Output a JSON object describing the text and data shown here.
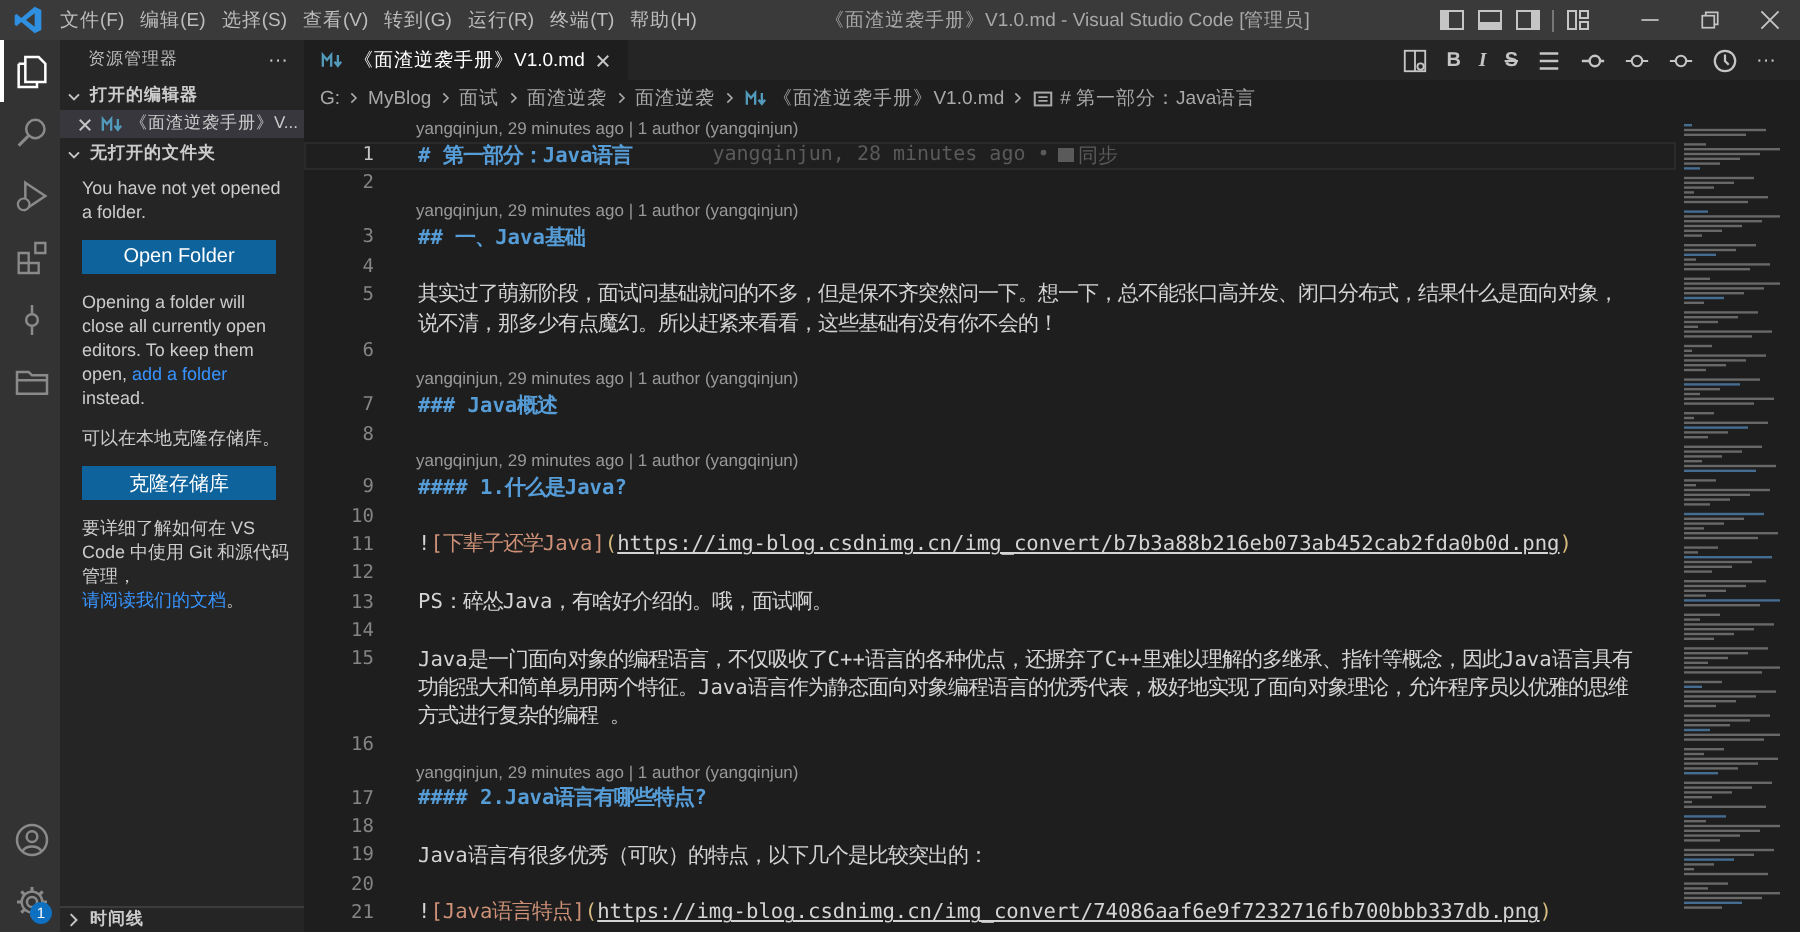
{
  "title_bar": {
    "menus": [
      "文件(F)",
      "编辑(E)",
      "选择(S)",
      "查看(V)",
      "转到(G)",
      "运行(R)",
      "终端(T)",
      "帮助(H)"
    ],
    "title": "《面渣逆袭手册》V1.0.md - Visual Studio Code [管理员]"
  },
  "activity_bar": {
    "items": [
      {
        "kind": "files",
        "selected": true
      },
      {
        "kind": "search",
        "selected": false
      },
      {
        "kind": "run",
        "selected": false
      },
      {
        "kind": "extensions",
        "selected": false
      },
      {
        "kind": "scm",
        "selected": false
      },
      {
        "kind": "folder",
        "selected": false
      }
    ],
    "bottom": [
      {
        "kind": "account"
      },
      {
        "kind": "gear",
        "badge": "1"
      }
    ]
  },
  "sidebar": {
    "title": "资源管理器",
    "more": "···",
    "sections": [
      {
        "kind": "open_editors",
        "title": "打开的编辑器",
        "expanded": true,
        "items": [
          {
            "label": "《面渣逆袭手册》V..."
          }
        ]
      },
      {
        "kind": "welcome",
        "title": "无打开的文件夹",
        "expanded": true,
        "blocks": [
          {
            "kind": "para",
            "parts": [
              {
                "kind": "text",
                "text": "You have not yet opened a folder."
              }
            ]
          },
          {
            "kind": "button",
            "text": "Open Folder"
          },
          {
            "kind": "para",
            "parts": [
              {
                "kind": "text",
                "text": "Opening a folder will close all currently open editors. To keep them open, "
              },
              {
                "kind": "link",
                "text": "add a folder"
              },
              {
                "kind": "text",
                "text": " instead."
              }
            ]
          },
          {
            "kind": "para",
            "parts": [
              {
                "kind": "text",
                "text": "可以在本地克隆存储库。"
              }
            ]
          },
          {
            "kind": "button",
            "text": "克隆存储库"
          },
          {
            "kind": "para",
            "parts": [
              {
                "kind": "text",
                "text": "要详细了解如何在 VS Code 中使用 Git 和源代码管理，"
              },
              {
                "kind": "link",
                "text": "请阅读我们的文档"
              },
              {
                "kind": "text",
                "text": "。"
              }
            ]
          }
        ]
      },
      {
        "kind": "timeline",
        "title": "时间线",
        "expanded": false
      }
    ]
  },
  "editor": {
    "tab": {
      "label": "《面渣逆袭手册》V1.0.md",
      "selected": true
    },
    "toolbar": [
      {
        "kind": "preview"
      },
      {
        "kind": "bold",
        "text": "B"
      },
      {
        "kind": "italic",
        "text": "I"
      },
      {
        "kind": "strike",
        "text": "S"
      },
      {
        "kind": "list"
      },
      {
        "kind": "commit"
      },
      {
        "kind": "ring"
      },
      {
        "kind": "ring"
      },
      {
        "kind": "history"
      },
      {
        "kind": "more",
        "text": "···"
      }
    ],
    "breadcrumbs": [
      {
        "kind": "folder",
        "text": "G:"
      },
      {
        "kind": "folder",
        "text": "MyBlog"
      },
      {
        "kind": "folder",
        "text": "面试"
      },
      {
        "kind": "folder",
        "text": "面渣逆袭"
      },
      {
        "kind": "folder",
        "text": "面渣逆袭"
      },
      {
        "kind": "file",
        "text": "《面渣逆袭手册》V1.0.md"
      },
      {
        "kind": "symbol",
        "text": "# 第一部分：Java语言"
      }
    ],
    "lines": [
      {
        "kind": "codelens",
        "text": "yangqinjun, 29 minutes ago | 1 author (yangqinjun)"
      },
      {
        "kind": "code",
        "number": "1",
        "current": true,
        "rows": [
          [
            {
              "kind": "heading",
              "text": "# 第一部分：Java语言"
            }
          ]
        ],
        "blame": {
          "text": "yangqinjun, 28 minutes ago •",
          "sync": "同步"
        }
      },
      {
        "kind": "code",
        "number": "2",
        "current": false
      },
      {
        "kind": "codelens",
        "text": "yangqinjun, 29 minutes ago | 1 author (yangqinjun)"
      },
      {
        "kind": "code",
        "number": "3",
        "current": false,
        "rows": [
          [
            {
              "kind": "heading",
              "text": "## 一、Java基础"
            }
          ]
        ]
      },
      {
        "kind": "code",
        "number": "4",
        "current": false
      },
      {
        "kind": "code",
        "number": "5",
        "current": false,
        "rows": [
          [
            {
              "kind": "plain",
              "text": "其实过了萌新阶段，面试问基础就问的不多，但是保不齐突然问一下。想一下，总不能张口高并发、闭口分布式，结果什么是面向对象，"
            }
          ],
          [
            {
              "kind": "plain",
              "text": "说不清，那多少有点魔幻。所以赶紧来看看，这些基础有没有你不会的！"
            }
          ]
        ]
      },
      {
        "kind": "code",
        "number": "6",
        "current": false
      },
      {
        "kind": "codelens",
        "text": "yangqinjun, 29 minutes ago | 1 author (yangqinjun)"
      },
      {
        "kind": "code",
        "number": "7",
        "current": false,
        "rows": [
          [
            {
              "kind": "heading",
              "text": "### Java概述"
            }
          ]
        ]
      },
      {
        "kind": "code",
        "number": "8",
        "current": false
      },
      {
        "kind": "codelens",
        "text": "yangqinjun, 29 minutes ago | 1 author (yangqinjun)"
      },
      {
        "kind": "code",
        "number": "9",
        "current": false,
        "rows": [
          [
            {
              "kind": "heading",
              "text": "#### 1.什么是Java?"
            }
          ]
        ]
      },
      {
        "kind": "code",
        "number": "10",
        "current": false
      },
      {
        "kind": "code",
        "number": "11",
        "current": false,
        "rows": [
          [
            {
              "kind": "plain",
              "text": "!"
            },
            {
              "kind": "label",
              "text": "[下辈子还学Java]"
            },
            {
              "kind": "paren",
              "text": "("
            },
            {
              "kind": "url",
              "text": "https://img-blog.csdnimg.cn/img_convert/b7b3a88b216eb073ab452cab2fda0b0d.png"
            },
            {
              "kind": "paren",
              "text": ")"
            }
          ]
        ]
      },
      {
        "kind": "code",
        "number": "12",
        "current": false
      },
      {
        "kind": "code",
        "number": "13",
        "current": false,
        "rows": [
          [
            {
              "kind": "plain",
              "text": "PS：碎怂Java，有啥好介绍的。哦，面试啊。"
            }
          ]
        ]
      },
      {
        "kind": "code",
        "number": "14",
        "current": false
      },
      {
        "kind": "code",
        "number": "15",
        "current": false,
        "rows": [
          [
            {
              "kind": "plain",
              "text": "Java是一门面向对象的编程语言，不仅吸收了C++语言的各种优点，还摒弃了C++里难以理解的多继承、指针等概念，因此Java语言具有"
            }
          ],
          [
            {
              "kind": "plain",
              "text": "功能强大和简单易用两个特征。Java语言作为静态面向对象编程语言的优秀代表，极好地实现了面向对象理论，允许程序员以优雅的思维"
            }
          ],
          [
            {
              "kind": "plain",
              "text": "方式进行复杂的编程 。"
            }
          ]
        ]
      },
      {
        "kind": "code",
        "number": "16",
        "current": false
      },
      {
        "kind": "codelens",
        "text": "yangqinjun, 29 minutes ago | 1 author (yangqinjun)"
      },
      {
        "kind": "code",
        "number": "17",
        "current": false,
        "rows": [
          [
            {
              "kind": "heading",
              "text": "#### 2.Java语言有哪些特点?"
            }
          ]
        ]
      },
      {
        "kind": "code",
        "number": "18",
        "current": false
      },
      {
        "kind": "code",
        "number": "19",
        "current": false,
        "rows": [
          [
            {
              "kind": "plain",
              "text": "Java语言有很多优秀（可吹）的特点，以下几个是比较突出的："
            }
          ]
        ]
      },
      {
        "kind": "code",
        "number": "20",
        "current": false
      },
      {
        "kind": "code",
        "number": "21",
        "current": false,
        "rows": [
          [
            {
              "kind": "plain",
              "text": "!"
            },
            {
              "kind": "label",
              "text": "[Java语言特点]"
            },
            {
              "kind": "paren",
              "text": "("
            },
            {
              "kind": "url",
              "text": "https://img-blog.csdnimg.cn/img_convert/74086aaf6e9f7232716fb700bbb337db.png"
            },
            {
              "kind": "paren",
              "text": ")"
            }
          ]
        ]
      }
    ]
  }
}
